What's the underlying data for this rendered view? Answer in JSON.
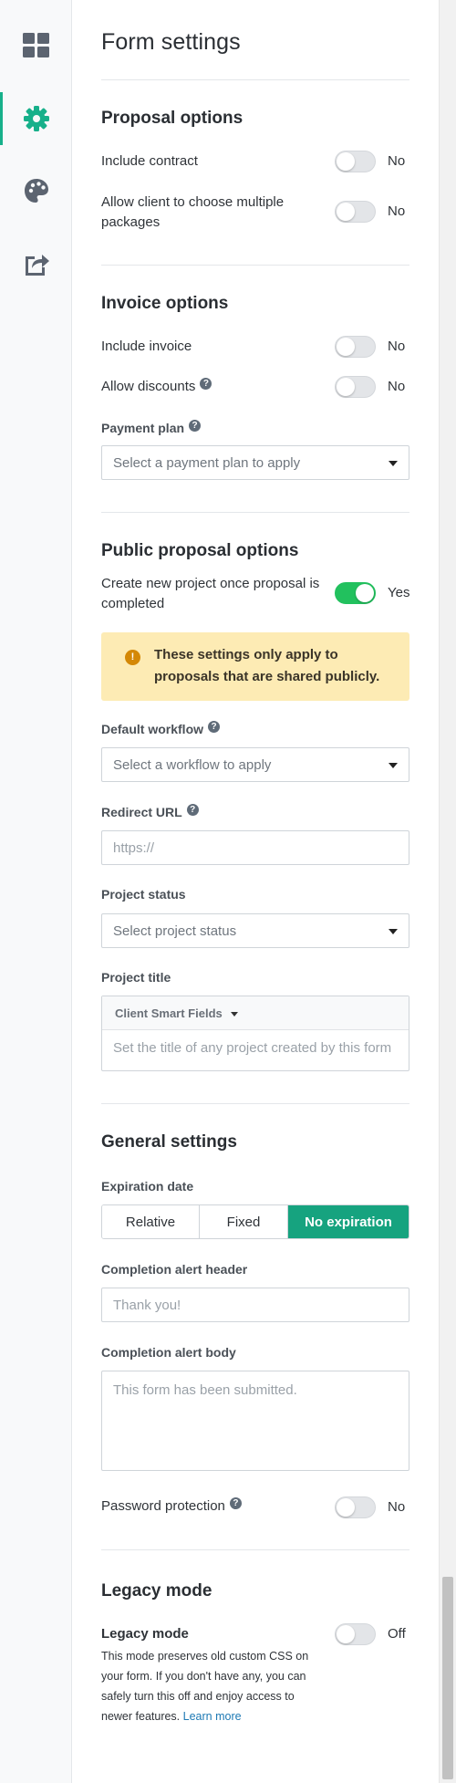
{
  "page": {
    "title": "Form settings"
  },
  "sidebar": {
    "items": [
      {
        "name": "dashboard",
        "icon": "grid-icon",
        "active": false
      },
      {
        "name": "settings",
        "icon": "gear-icon",
        "active": true
      },
      {
        "name": "theme",
        "icon": "palette-icon",
        "active": false
      },
      {
        "name": "share",
        "icon": "share-icon",
        "active": false
      }
    ],
    "accent_color": "#17b08a"
  },
  "proposal_options": {
    "title": "Proposal options",
    "include_contract": {
      "label": "Include contract",
      "state": "No"
    },
    "multiple_packages": {
      "label": "Allow client to choose multiple packages",
      "state": "No"
    }
  },
  "invoice_options": {
    "title": "Invoice options",
    "include_invoice": {
      "label": "Include invoice",
      "state": "No"
    },
    "allow_discounts": {
      "label": "Allow discounts",
      "state": "No"
    },
    "payment_plan": {
      "label": "Payment plan",
      "placeholder": "Select a payment plan to apply"
    }
  },
  "public_proposal_options": {
    "title": "Public proposal options",
    "create_project": {
      "label": "Create new project once proposal is completed",
      "state": "Yes",
      "on": true
    },
    "alert": {
      "text": "These settings only apply to proposals that are shared publicly.",
      "icon": "warning-icon"
    },
    "default_workflow": {
      "label": "Default workflow",
      "placeholder": "Select a workflow to apply"
    },
    "redirect_url": {
      "label": "Redirect URL",
      "placeholder": "https://"
    },
    "project_status": {
      "label": "Project status",
      "placeholder": "Select project status"
    },
    "project_title": {
      "label": "Project title",
      "smart_fields_label": "Client Smart Fields",
      "placeholder": "Set the title of any project created by this form"
    }
  },
  "general_settings": {
    "title": "General settings",
    "expiration": {
      "label": "Expiration date",
      "options": [
        "Relative",
        "Fixed",
        "No expiration"
      ],
      "selected": "No expiration"
    },
    "alert_header": {
      "label": "Completion alert header",
      "placeholder": "Thank you!"
    },
    "alert_body": {
      "label": "Completion alert body",
      "placeholder": "This form has been submitted."
    },
    "password_protection": {
      "label": "Password protection",
      "state": "No"
    }
  },
  "legacy": {
    "title": "Legacy mode",
    "toggle": {
      "label": "Legacy mode",
      "state": "Off"
    },
    "description": "This mode preserves old custom CSS on your form. If you don't have any, you can safely turn this off and enjoy access to newer features.",
    "learn_more": "Learn more"
  },
  "help_glyph": "?",
  "alert_glyph": "!",
  "colors": {
    "toggle_on": "#22c15e",
    "segment_selected": "#16a37f",
    "link": "#1d79b4",
    "alert_bg": "#fdebb4"
  }
}
